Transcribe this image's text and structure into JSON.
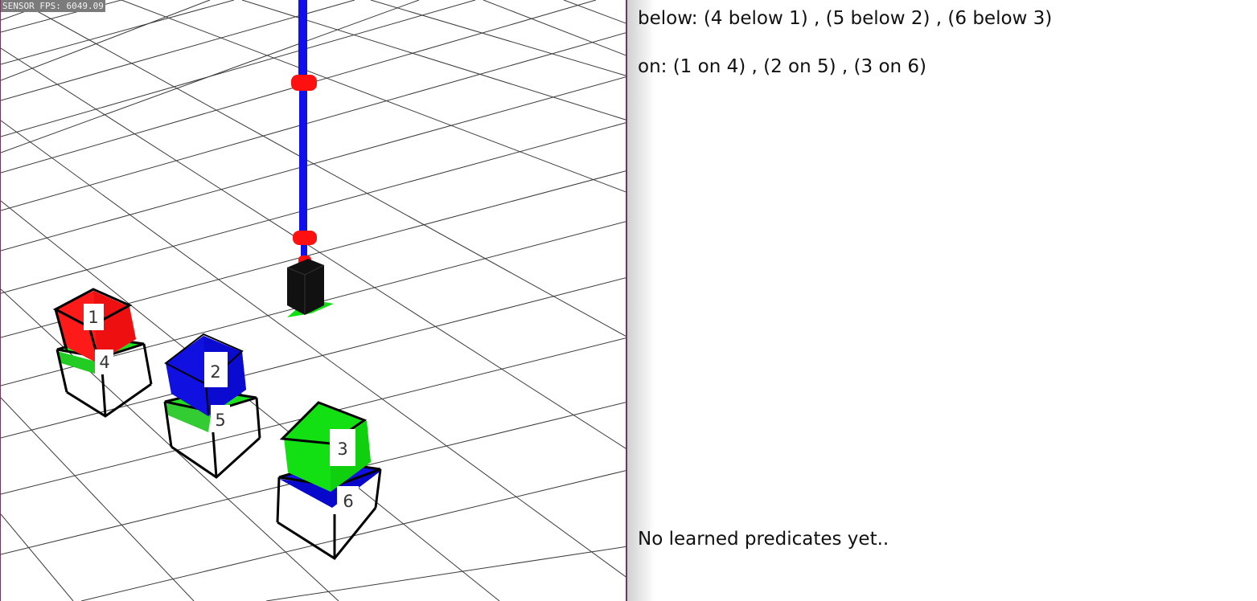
{
  "viewport": {
    "fps_label": "SENSOR FPS: 6049.09",
    "blocks": [
      {
        "id": "1",
        "color": "#ff1a1a"
      },
      {
        "id": "2",
        "color": "#1010e0"
      },
      {
        "id": "3",
        "color": "#12e012"
      },
      {
        "id": "4",
        "color": "#1fe01f"
      },
      {
        "id": "5",
        "color": "#1fe01f"
      },
      {
        "id": "6",
        "color": "#1010e0"
      }
    ],
    "robot": {
      "arm_color": "#1010ee",
      "joint_color": "#ff1010",
      "gripper_color": "#111111",
      "marker_color": "#10e010"
    }
  },
  "panel": {
    "below_text": "below: (4 below 1) , (5 below 2) , (6 below 3)",
    "on_text": "on: (1 on 4) , (2 on 5) , (3 on 6)",
    "learned_text": "No learned predicates yet.."
  }
}
